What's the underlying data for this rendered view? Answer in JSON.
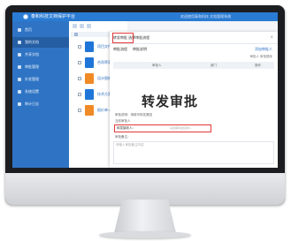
{
  "app": {
    "title": "泰和科技文档保护平台",
    "top_info": "欢迎使用泰和科技 文档管理系统"
  },
  "sidebar": {
    "items": [
      {
        "label": "首页"
      },
      {
        "label": "我的文档"
      },
      {
        "label": "共享文档"
      },
      {
        "label": "审批管理"
      },
      {
        "label": "外发管理"
      },
      {
        "label": "系统设置"
      },
      {
        "label": "审计日志"
      }
    ]
  },
  "file_list": {
    "rows": [
      {
        "name": "项目文件.docx",
        "type": "blue"
      },
      {
        "name": "合同草案.docx",
        "type": "blue"
      },
      {
        "name": "设计图纸.pdf",
        "type": "orange"
      },
      {
        "name": "技术方案.docx",
        "type": "blue"
      },
      {
        "name": "报价单.xlsx",
        "type": "orange"
      }
    ]
  },
  "dialog": {
    "header": "转发审批 选择审批流程",
    "tabs": [
      "审批流程",
      "审批说明"
    ],
    "link": "添加审批人",
    "right_labels": "审批人  审批顺序",
    "grid_headers": [
      "审批人",
      "部门",
      "操作"
    ],
    "big_title": "转发审批",
    "form_lines": [
      "审批说明：请填写转发原因",
      "当前审批人"
    ],
    "field_label": "转发接收人：",
    "field_hint": "请选择转发接收人",
    "note_label": "审批备注：",
    "note_placeholder": "请输入审批备注内容"
  },
  "colors": {
    "topbar": "#2a7bd3",
    "sidebar": "#2f74c4",
    "highlight": "#e23a3a"
  }
}
